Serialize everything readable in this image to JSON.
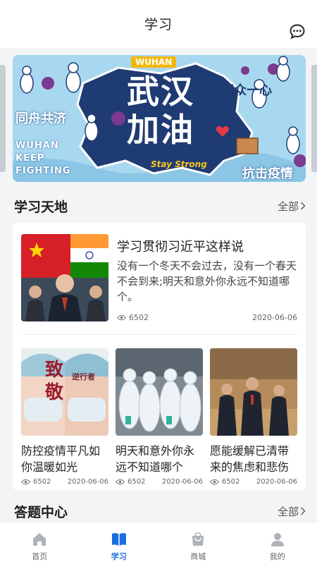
{
  "header": {
    "title": "学习",
    "chat_icon": "chat-bubble-icon"
  },
  "banner": {
    "tag": "WUHAN",
    "main_line1": "武汉",
    "main_line2": "加油",
    "left_slogan": "同舟共济",
    "right_slogan_top": "万众一心",
    "right_slogan_bottom": "抗击疫情",
    "keep_lines": [
      "WUHAN",
      "KEEP",
      "FIGHTING"
    ],
    "stay_strong": "Stay Strong"
  },
  "study_section": {
    "title": "学习天地",
    "more": "全部"
  },
  "feature_article": {
    "title": "学习贯彻习近平这样说",
    "desc": "没有一个冬天不会过去，没有一个春天不会到来;明天和意外你永远不知道哪个。",
    "views": "6502",
    "date": "2020-06-06"
  },
  "articles": [
    {
      "title": "防控疫情平凡如你温暖如光",
      "views": "6502",
      "date": "2020-06-06",
      "img_text_1": "致",
      "img_text_2": "敬",
      "img_text_3": "逆行者"
    },
    {
      "title": "明天和意外你永远不知道哪个",
      "views": "6502",
      "date": "2020-06-06"
    },
    {
      "title": "愿能缓解已清带来的焦虑和悲伤",
      "views": "6502",
      "date": "2020-06-06"
    }
  ],
  "quiz_section": {
    "title": "答题中心",
    "more": "全部"
  },
  "nav": [
    {
      "label": "首页",
      "icon": "home-icon",
      "active": false
    },
    {
      "label": "学习",
      "icon": "book-icon",
      "active": true
    },
    {
      "label": "商城",
      "icon": "shopping-bag-icon",
      "active": false
    },
    {
      "label": "我的",
      "icon": "user-icon",
      "active": false
    }
  ],
  "colors": {
    "accent": "#1a6fe0",
    "banner_sky": "#a8d8f0",
    "banner_map": "#1f3b73",
    "tag_yellow": "#f2b705"
  }
}
